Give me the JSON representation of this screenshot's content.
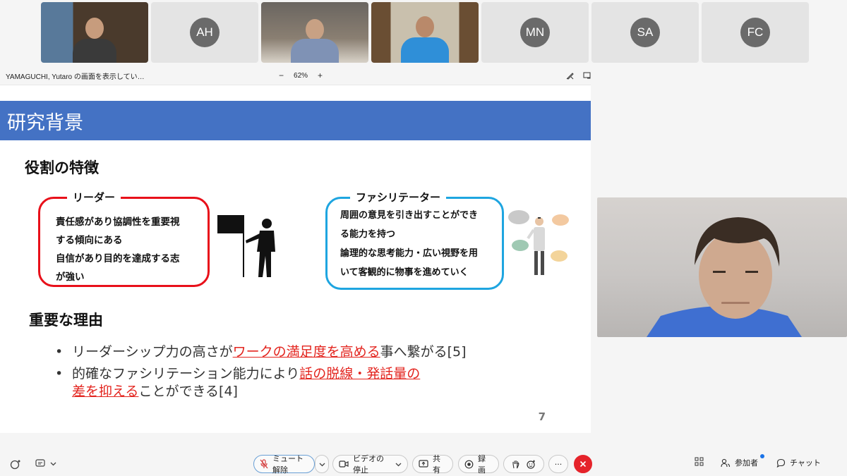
{
  "participants": [
    {
      "initials": "",
      "kind": "video"
    },
    {
      "initials": "AH",
      "kind": "avatar"
    },
    {
      "initials": "",
      "kind": "video"
    },
    {
      "initials": "",
      "kind": "video"
    },
    {
      "initials": "MN",
      "kind": "avatar"
    },
    {
      "initials": "SA",
      "kind": "avatar"
    },
    {
      "initials": "FC",
      "kind": "avatar"
    }
  ],
  "share": {
    "title": "YAMAGUCHI, Yutaro の画面を表示してい…",
    "zoom_out": "−",
    "zoom_level": "62%",
    "zoom_in": "+"
  },
  "slide": {
    "header": "研究背景",
    "section1": "役割の特徴",
    "leader": {
      "label": "リーダー",
      "lines": [
        "責任感があり協調性を重要視",
        "する傾向にある",
        "自信があり目的を達成する志",
        "が強い"
      ]
    },
    "facilitator": {
      "label": "ファシリテーター",
      "lines": [
        "周囲の意見を引き出すことができ",
        "る能力を持つ",
        "論理的な思考能力・広い視野を用",
        "いて客観的に物事を進めていく"
      ]
    },
    "section2": "重要な理由",
    "bullet1": {
      "before": "リーダーシップ力の高さが",
      "highlight": "ワークの満足度を高める",
      "after": "事へ繋がる[5]"
    },
    "bullet2": {
      "before": "的確なファシリテーション能力により",
      "highlight1": "話の脱線・発話量の",
      "highlight2": "差を抑える",
      "after": "ことができる[4]"
    },
    "page_number": "7"
  },
  "toolbar": {
    "mute": "ミュート解除",
    "video": "ビデオの停止",
    "share": "共有",
    "record": "録画",
    "more": "···",
    "participants": "参加者",
    "chat": "チャット"
  },
  "colors": {
    "header_blue": "#4472c4",
    "leader_red": "#e8101a",
    "facilitator_blue": "#1ea5e0",
    "highlight_red": "#e3251f",
    "leave_red": "#e5232a"
  }
}
